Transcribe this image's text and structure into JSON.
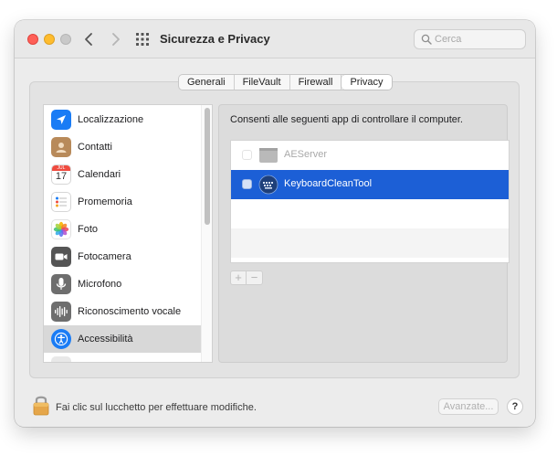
{
  "window": {
    "title": "Sicurezza e Privacy",
    "search_placeholder": "Cerca"
  },
  "tabs": [
    {
      "label": "Generali",
      "active": false
    },
    {
      "label": "FileVault",
      "active": false
    },
    {
      "label": "Firewall",
      "active": false
    },
    {
      "label": "Privacy",
      "active": true
    }
  ],
  "sidebar": {
    "items": [
      {
        "label": "Localizzazione",
        "icon": "location-arrow-icon",
        "color": "#1a7cf5"
      },
      {
        "label": "Contatti",
        "icon": "contacts-icon",
        "color": "#b88a5a"
      },
      {
        "label": "Calendari",
        "icon": "calendar-icon",
        "color": "#ffffff",
        "cal_month": "JUL",
        "cal_day": "17"
      },
      {
        "label": "Promemoria",
        "icon": "reminders-icon",
        "color": "#ffffff"
      },
      {
        "label": "Foto",
        "icon": "photos-icon",
        "color": "#ffffff"
      },
      {
        "label": "Fotocamera",
        "icon": "camera-icon",
        "color": "#555555"
      },
      {
        "label": "Microfono",
        "icon": "microphone-icon",
        "color": "#6e6e6e"
      },
      {
        "label": "Riconoscimento vocale",
        "icon": "speech-recognition-icon",
        "color": "#6e6e6e"
      },
      {
        "label": "Accessibilità",
        "icon": "accessibility-icon",
        "color": "#1a7cf5",
        "selected": true
      }
    ]
  },
  "content": {
    "caption": "Consenti alle seguenti app di controllare il computer.",
    "apps": [
      {
        "name": "AEServer",
        "checked": false,
        "disabled": true,
        "icon": "aeserver-icon"
      },
      {
        "name": "KeyboardCleanTool",
        "checked": false,
        "selected": true,
        "icon": "keyboard-clean-tool-icon"
      }
    ],
    "add_label": "+",
    "remove_label": "−"
  },
  "footer": {
    "lock_text": "Fai clic sul lucchetto per effettuare modifiche.",
    "advanced_label": "Avanzate...",
    "help_label": "?"
  },
  "colors": {
    "accent": "#1c5fd6",
    "close": "#fe5f57",
    "minimize": "#febc2e"
  }
}
